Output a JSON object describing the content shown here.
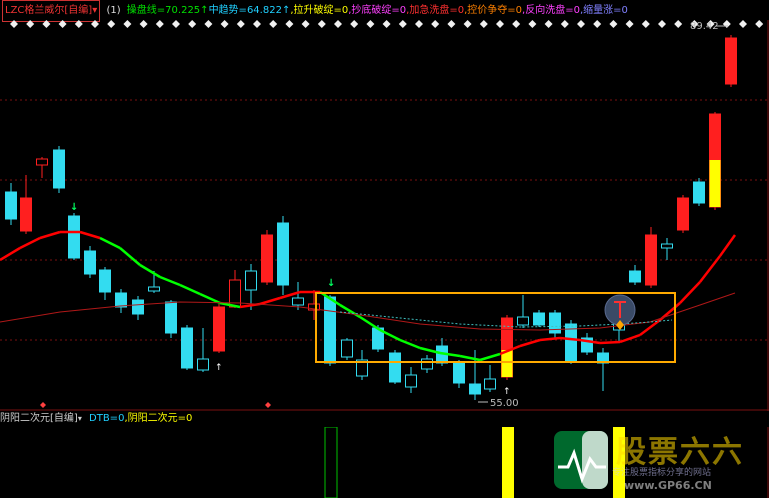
{
  "header": {
    "indicator_select": "LZC格兰威尔[自编]",
    "period": "(1)",
    "items": [
      {
        "text": "操盘线=70.225",
        "color": "#00e000"
      },
      {
        "text": "↑",
        "color": "#00e000"
      },
      {
        "text": "中趋势=64.822",
        "color": "#20d0ff"
      },
      {
        "text": "↑",
        "color": "#20d0ff"
      },
      {
        "text": ",拉升破绽=0",
        "color": "#ffff00"
      },
      {
        "text": ",抄底破绽=0",
        "color": "#ff40ff"
      },
      {
        "text": ",加急洗盘=0",
        "color": "#ff3030"
      },
      {
        "text": ",控价争夺=0",
        "color": "#ff8000"
      },
      {
        "text": ",反向洗盘=0",
        "color": "#ff40ff"
      },
      {
        "text": ",缩量涨=0",
        "color": "#8080ff"
      }
    ]
  },
  "price_labels": {
    "high": "89.42",
    "low": "55.00"
  },
  "colors": {
    "up": "#ff1f1f",
    "down": "#33dcf0",
    "operate_up": "#00ff00",
    "operate_down": "#ff0000",
    "box": "#ffaa00",
    "highlight": "#ffff00"
  },
  "sub_header": {
    "indicator_select": "阴阳二次元[自编]",
    "values": [
      {
        "text": "DTB=0",
        "color": "#20d0ff"
      },
      {
        "text": ",阴阳二次元=0",
        "color": "#ffff00"
      }
    ]
  },
  "watermark": {
    "title": "股票六六",
    "subtitle": "专注股票指标分享的网站",
    "url": "www.GP66.CN"
  },
  "icons": [
    "diamond-marker-icon",
    "arrow-up-icon",
    "arrow-down-icon",
    "robot-icon",
    "chevron-down-icon"
  ]
}
